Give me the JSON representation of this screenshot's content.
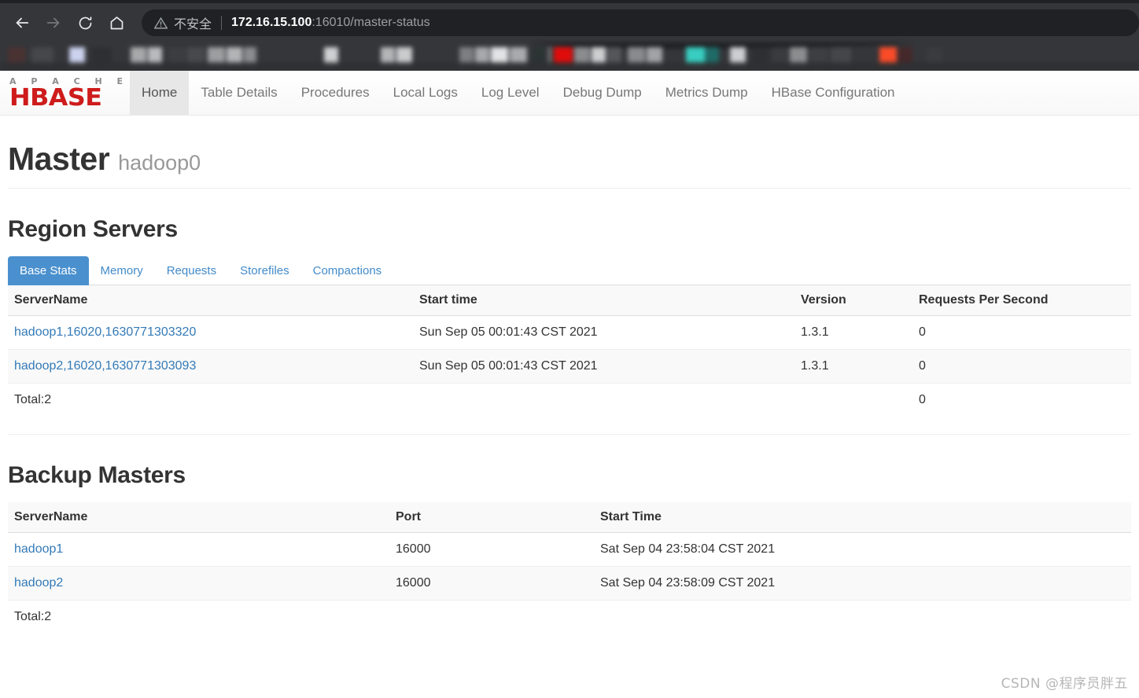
{
  "browser": {
    "back_icon": "arrow-left-icon",
    "forward_icon": "arrow-right-icon",
    "reload_icon": "reload-icon",
    "home_icon": "home-icon",
    "security_icon": "warning-triangle-icon",
    "security_label": "不安全",
    "url_host": "172.16.15.100",
    "url_rest": ":16010/master-status",
    "bookmarks_redacted": true,
    "toolbar_bg": "#35363a",
    "omnibox_bg": "#202124"
  },
  "navbar": {
    "brand_top": "A P A C H E",
    "brand_main": "HBASE",
    "brand_color": "#ce1b1b",
    "links": [
      {
        "label": "Home",
        "active": true
      },
      {
        "label": "Table Details",
        "active": false
      },
      {
        "label": "Procedures",
        "active": false
      },
      {
        "label": "Local Logs",
        "active": false
      },
      {
        "label": "Log Level",
        "active": false
      },
      {
        "label": "Debug Dump",
        "active": false
      },
      {
        "label": "Metrics Dump",
        "active": false
      },
      {
        "label": "HBase Configuration",
        "active": false
      }
    ]
  },
  "header": {
    "title": "Master",
    "subtitle": "hadoop0"
  },
  "region_servers": {
    "section_title": "Region Servers",
    "accent_color": "#4a90ce",
    "tabs": [
      {
        "label": "Base Stats",
        "active": true
      },
      {
        "label": "Memory",
        "active": false
      },
      {
        "label": "Requests",
        "active": false
      },
      {
        "label": "Storefiles",
        "active": false
      },
      {
        "label": "Compactions",
        "active": false
      }
    ],
    "columns": [
      "ServerName",
      "Start time",
      "Version",
      "Requests Per Second"
    ],
    "rows": [
      {
        "server_name": "hadoop1,16020,1630771303320",
        "start_time": "Sun Sep 05 00:01:43 CST 2021",
        "version": "1.3.1",
        "rps": "0"
      },
      {
        "server_name": "hadoop2,16020,1630771303093",
        "start_time": "Sun Sep 05 00:01:43 CST 2021",
        "version": "1.3.1",
        "rps": "0"
      }
    ],
    "total_label": "Total:2",
    "total_rps": "0"
  },
  "backup_masters": {
    "section_title": "Backup Masters",
    "columns": [
      "ServerName",
      "Port",
      "Start Time"
    ],
    "rows": [
      {
        "server_name": "hadoop1",
        "port": "16000",
        "start_time": "Sat Sep 04 23:58:04 CST 2021"
      },
      {
        "server_name": "hadoop2",
        "port": "16000",
        "start_time": "Sat Sep 04 23:58:09 CST 2021"
      }
    ],
    "total_label": "Total:2"
  },
  "watermark": "CSDN @程序员胖五"
}
